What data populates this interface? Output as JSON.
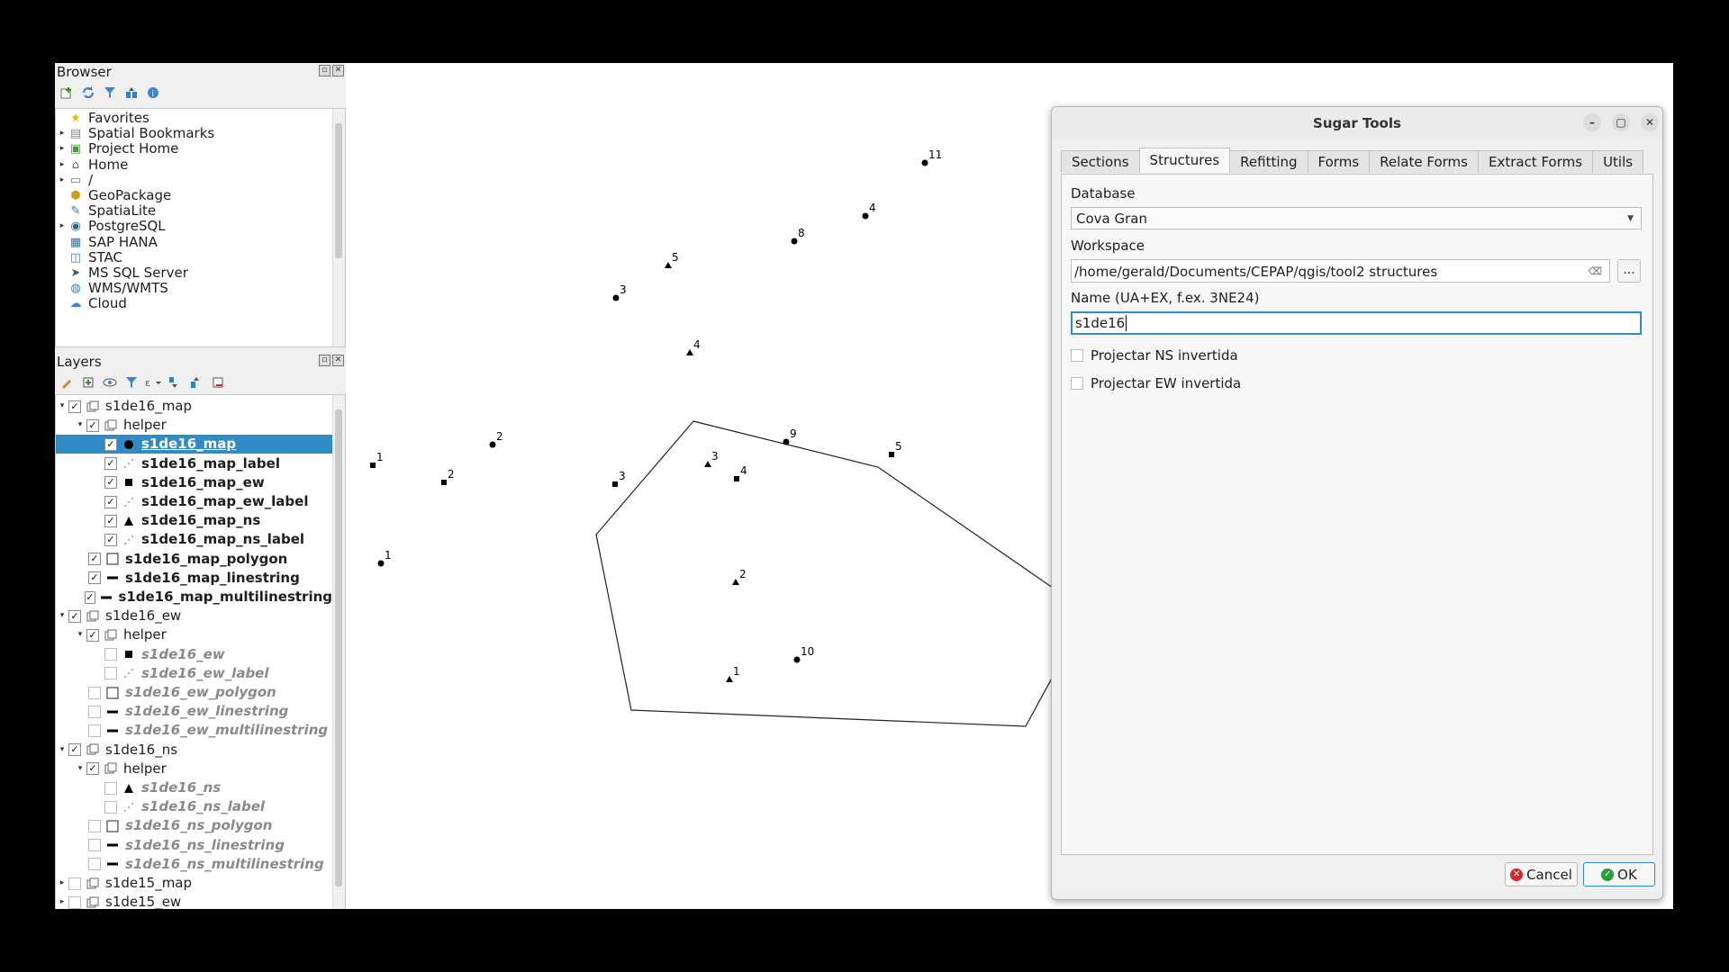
{
  "browser": {
    "title": "Browser",
    "items": [
      {
        "label": "Favorites",
        "icon": "star-icon",
        "arrow": ""
      },
      {
        "label": "Spatial Bookmarks",
        "icon": "bookmark-icon",
        "arrow": "▸"
      },
      {
        "label": "Project Home",
        "icon": "project-home-icon",
        "arrow": "▸"
      },
      {
        "label": "Home",
        "icon": "home-folder-icon",
        "arrow": "▸"
      },
      {
        "label": "/",
        "icon": "folder-icon",
        "arrow": "▸"
      },
      {
        "label": "GeoPackage",
        "icon": "geopackage-icon",
        "arrow": ""
      },
      {
        "label": "SpatiaLite",
        "icon": "spatialite-icon",
        "arrow": ""
      },
      {
        "label": "PostgreSQL",
        "icon": "postgresql-icon",
        "arrow": "▸"
      },
      {
        "label": "SAP HANA",
        "icon": "sap-hana-icon",
        "arrow": ""
      },
      {
        "label": "STAC",
        "icon": "stac-icon",
        "arrow": ""
      },
      {
        "label": "MS SQL Server",
        "icon": "mssql-icon",
        "arrow": ""
      },
      {
        "label": "WMS/WMTS",
        "icon": "wms-icon",
        "arrow": ""
      },
      {
        "label": "Cloud",
        "icon": "cloud-icon",
        "arrow": ""
      }
    ]
  },
  "layers": {
    "title": "Layers",
    "items": [
      {
        "label": "s1de16_map",
        "level": 0,
        "arrow": "▾",
        "check": true,
        "icon": "group",
        "style": "normal",
        "selected": false
      },
      {
        "label": "helper",
        "level": 1,
        "arrow": "▾",
        "check": true,
        "icon": "group",
        "style": "normal",
        "selected": false
      },
      {
        "label": "s1de16_map",
        "level": 2,
        "arrow": "",
        "check": true,
        "icon": "dot",
        "style": "bold",
        "selected": true
      },
      {
        "label": "s1de16_map_label",
        "level": 2,
        "arrow": "",
        "check": true,
        "icon": "label",
        "style": "bold",
        "selected": false
      },
      {
        "label": "s1de16_map_ew",
        "level": 2,
        "arrow": "",
        "check": true,
        "icon": "square",
        "style": "bold",
        "selected": false
      },
      {
        "label": "s1de16_map_ew_label",
        "level": 2,
        "arrow": "",
        "check": true,
        "icon": "label",
        "style": "bold",
        "selected": false
      },
      {
        "label": "s1de16_map_ns",
        "level": 2,
        "arrow": "",
        "check": true,
        "icon": "triangle",
        "style": "bold",
        "selected": false
      },
      {
        "label": "s1de16_map_ns_label",
        "level": 2,
        "arrow": "",
        "check": true,
        "icon": "label",
        "style": "bold",
        "selected": false
      },
      {
        "label": "s1de16_map_polygon",
        "level": 1,
        "arrow": "",
        "check": true,
        "icon": "polygon",
        "style": "bold",
        "selected": false
      },
      {
        "label": "s1de16_map_linestring",
        "level": 1,
        "arrow": "",
        "check": true,
        "icon": "line",
        "style": "bold",
        "selected": false
      },
      {
        "label": "s1de16_map_multilinestring",
        "level": 1,
        "arrow": "",
        "check": true,
        "icon": "line",
        "style": "bold",
        "selected": false
      },
      {
        "label": "s1de16_ew",
        "level": 0,
        "arrow": "▾",
        "check": true,
        "icon": "group",
        "style": "normal",
        "selected": false
      },
      {
        "label": "helper",
        "level": 1,
        "arrow": "▾",
        "check": true,
        "icon": "group",
        "style": "normal",
        "selected": false
      },
      {
        "label": "s1de16_ew",
        "level": 2,
        "arrow": "",
        "check": false,
        "icon": "square",
        "style": "grey",
        "selected": false
      },
      {
        "label": "s1de16_ew_label",
        "level": 2,
        "arrow": "",
        "check": false,
        "icon": "label",
        "style": "grey",
        "selected": false
      },
      {
        "label": "s1de16_ew_polygon",
        "level": 1,
        "arrow": "",
        "check": false,
        "icon": "polygon",
        "style": "grey",
        "selected": false
      },
      {
        "label": "s1de16_ew_linestring",
        "level": 1,
        "arrow": "",
        "check": false,
        "icon": "line",
        "style": "grey",
        "selected": false
      },
      {
        "label": "s1de16_ew_multilinestring",
        "level": 1,
        "arrow": "",
        "check": false,
        "icon": "line",
        "style": "grey",
        "selected": false
      },
      {
        "label": "s1de16_ns",
        "level": 0,
        "arrow": "▾",
        "check": true,
        "icon": "group",
        "style": "normal",
        "selected": false
      },
      {
        "label": "helper",
        "level": 1,
        "arrow": "▾",
        "check": true,
        "icon": "group",
        "style": "normal",
        "selected": false
      },
      {
        "label": "s1de16_ns",
        "level": 2,
        "arrow": "",
        "check": false,
        "icon": "triangle",
        "style": "grey",
        "selected": false
      },
      {
        "label": "s1de16_ns_label",
        "level": 2,
        "arrow": "",
        "check": false,
        "icon": "label",
        "style": "grey",
        "selected": false
      },
      {
        "label": "s1de16_ns_polygon",
        "level": 1,
        "arrow": "",
        "check": false,
        "icon": "polygon",
        "style": "grey",
        "selected": false
      },
      {
        "label": "s1de16_ns_linestring",
        "level": 1,
        "arrow": "",
        "check": false,
        "icon": "line",
        "style": "grey",
        "selected": false
      },
      {
        "label": "s1de16_ns_multilinestring",
        "level": 1,
        "arrow": "",
        "check": false,
        "icon": "line",
        "style": "grey",
        "selected": false
      },
      {
        "label": "s1de15_map",
        "level": 0,
        "arrow": "▸",
        "check": false,
        "icon": "group",
        "style": "normal",
        "selected": false
      },
      {
        "label": "s1de15_ew",
        "level": 0,
        "arrow": "▸",
        "check": false,
        "icon": "group",
        "style": "normal",
        "selected": false
      }
    ]
  },
  "map": {
    "features": [
      {
        "kind": "dot",
        "label": "11"
      },
      {
        "kind": "dot",
        "label": "4"
      },
      {
        "kind": "dot",
        "label": "8"
      },
      {
        "kind": "triangle",
        "label": "5"
      },
      {
        "kind": "dot",
        "label": "3"
      },
      {
        "kind": "triangle",
        "label": "4"
      },
      {
        "kind": "dot",
        "label": "2"
      },
      {
        "kind": "square",
        "label": "1"
      },
      {
        "kind": "square",
        "label": "2"
      },
      {
        "kind": "dot",
        "label": "9"
      },
      {
        "kind": "square",
        "label": "5"
      },
      {
        "kind": "triangle",
        "label": "3"
      },
      {
        "kind": "square",
        "label": "4"
      },
      {
        "kind": "square",
        "label": "3"
      },
      {
        "kind": "dot",
        "label": "1"
      },
      {
        "kind": "triangle",
        "label": "2"
      },
      {
        "kind": "dot",
        "label": "10"
      },
      {
        "kind": "triangle",
        "label": "1"
      }
    ]
  },
  "dialog": {
    "title": "Sugar Tools",
    "tabs": [
      "Sections",
      "Structures",
      "Refitting",
      "Forms",
      "Relate Forms",
      "Extract Forms",
      "Utils"
    ],
    "active_tab": "Structures",
    "database_label": "Database",
    "database_value": "Cova Gran",
    "workspace_label": "Workspace",
    "workspace_value": "/home/gerald/Documents/CEPAP/qgis/tool2 structures",
    "browse_label": "...",
    "name_label": "Name (UA+EX, f.ex. 3NE24)",
    "name_value": "s1de16",
    "ns_checkbox_label": "Projectar NS invertida",
    "ew_checkbox_label": "Projectar EW invertida",
    "cancel_label": "Cancel",
    "ok_label": "OK"
  },
  "colors": {
    "selection": "#308cc6",
    "cancel_icon": "#d9262c",
    "ok_icon": "#2a9d3c"
  }
}
